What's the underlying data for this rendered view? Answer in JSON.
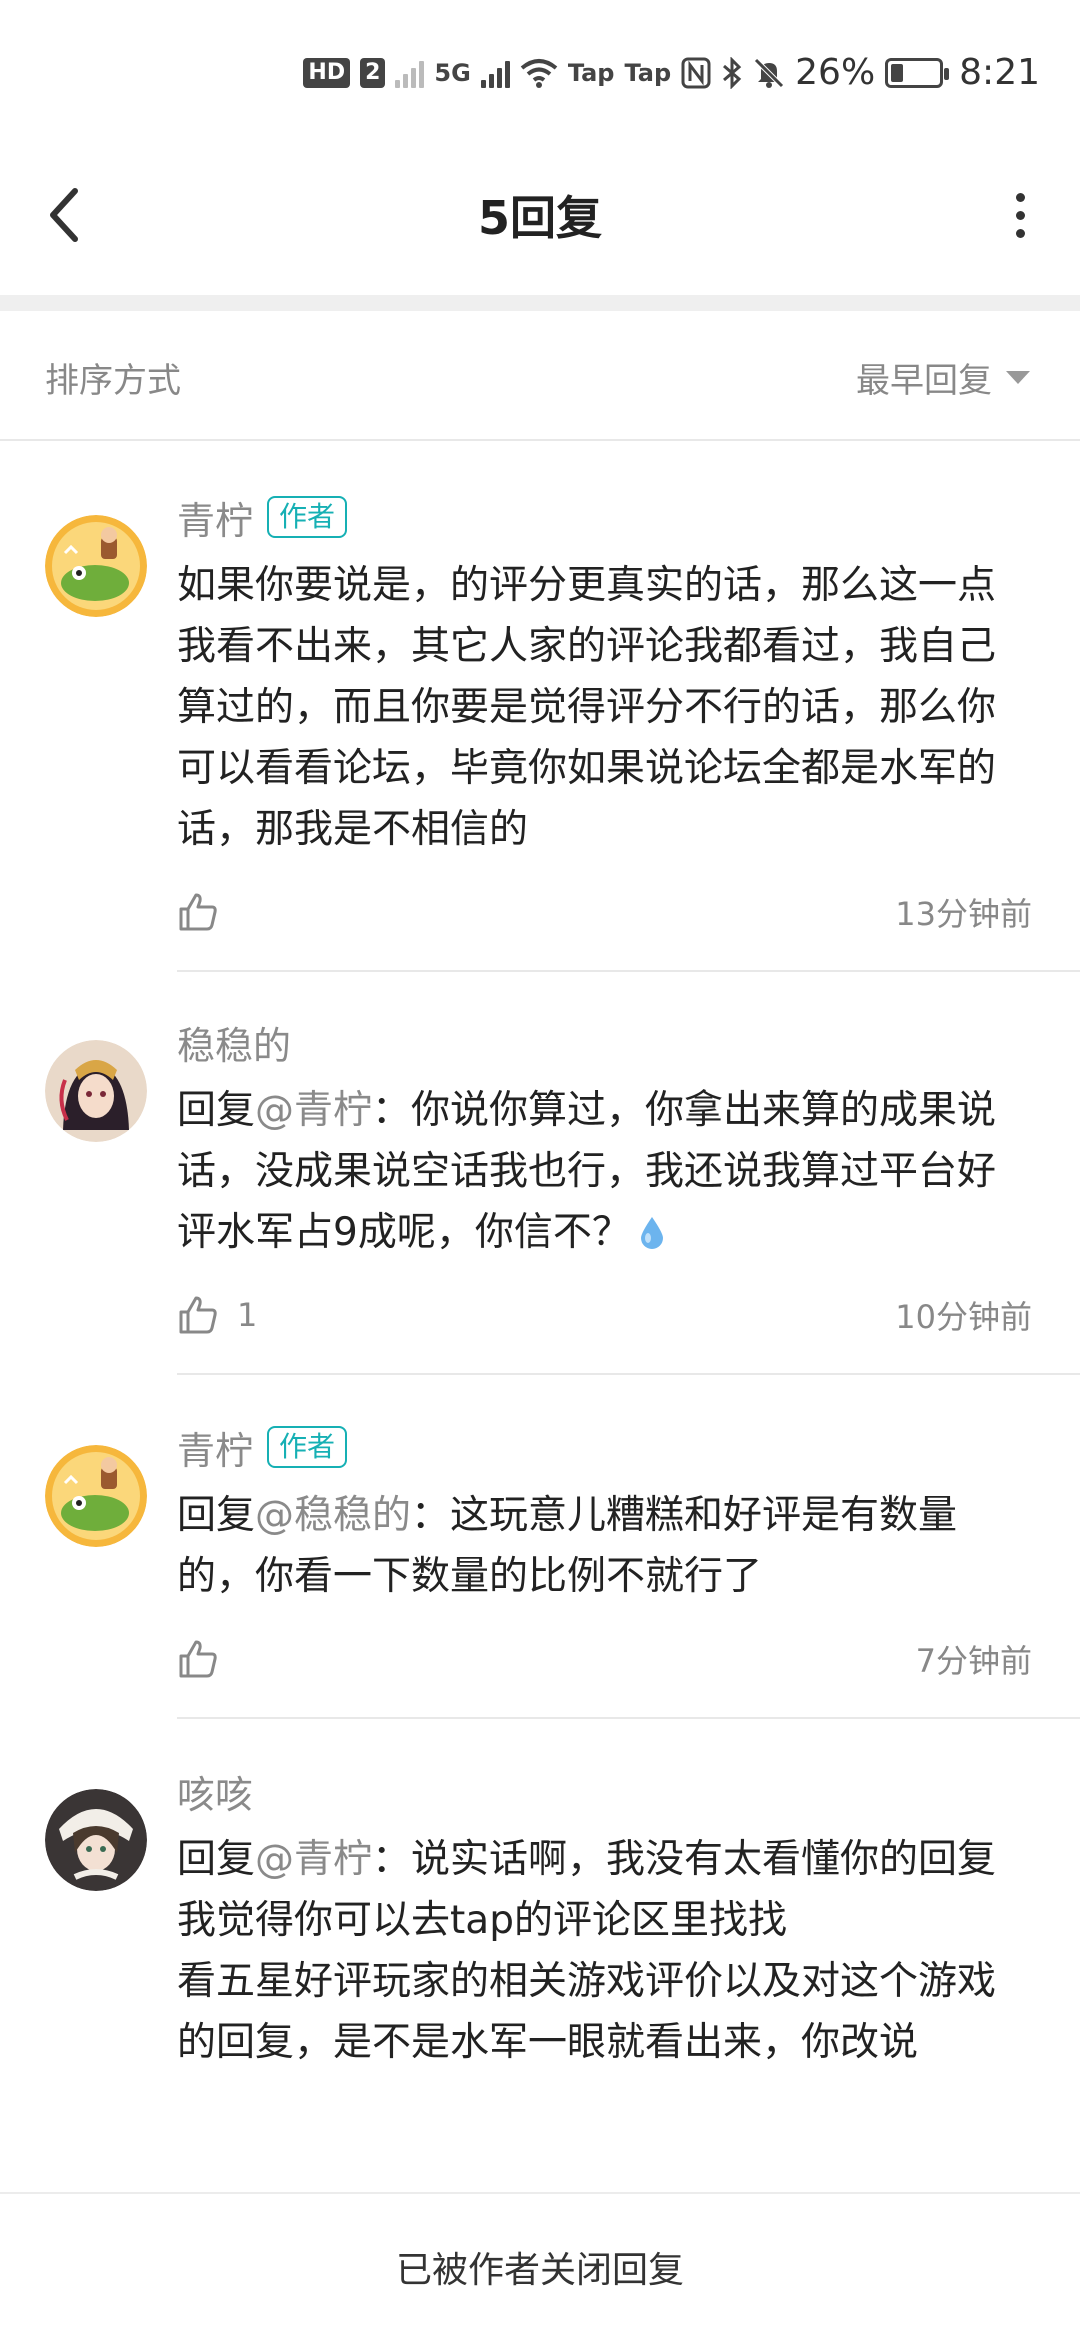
{
  "status_bar": {
    "hd_badge": "HD",
    "sim_badge": "2",
    "net_type": "5G",
    "tap1": "Tap",
    "tap2": "Tap",
    "battery": "26%",
    "battery_fill_fraction": 0.26,
    "time": "8:21",
    "icons": [
      "signal-icon",
      "wifi-icon",
      "nfc-icon",
      "bluetooth-icon",
      "mute-bell-icon",
      "battery-icon"
    ]
  },
  "header": {
    "title": "5回复",
    "back_icon": "chevron-left-icon",
    "more_icon": "more-vertical-icon"
  },
  "sort": {
    "label": "排序方式",
    "value": "最早回复"
  },
  "comments": [
    {
      "user": "青柠",
      "tag": "作者",
      "reply_prefix": "",
      "reply_to": "",
      "reply_sep": "",
      "text": "如果你要说是，的评分更真实的话，那么这一点我看不出来，其它人家的评论我都看过，我自己算过的，而且你要是觉得评分不行的话，那么你可以看看论坛，毕竟你如果说论坛全都是水军的话，那我是不相信的",
      "likes": "",
      "time": "13分钟前"
    },
    {
      "user": "稳稳的",
      "tag": "",
      "reply_prefix": "回复",
      "reply_to": "@青柠",
      "reply_sep": "：",
      "text": "你说你算过，你拿出来算的成果说话，没成果说空话我也行，我还说我算过平台好评水军占9成呢，你信不？",
      "likes": "1",
      "time": "10分钟前"
    },
    {
      "user": "青柠",
      "tag": "作者",
      "reply_prefix": "回复",
      "reply_to": "@稳稳的",
      "reply_sep": "：",
      "text": "这玩意儿糟糕和好评是有数量的，你看一下数量的比例不就行了",
      "likes": "",
      "time": "7分钟前"
    },
    {
      "user": "咳咳",
      "tag": "",
      "reply_prefix": "回复",
      "reply_to": "@青柠",
      "reply_sep": "：",
      "text": "说实话啊，我没有太看懂你的回复\n我觉得你可以去tap的评论区里找找\n看五星好评玩家的相关游戏评价以及对这个游戏的回复，是不是水军一眼就看出来，你改说",
      "likes": "",
      "time": ""
    }
  ],
  "bottom": {
    "text": "已被作者关闭回复"
  },
  "colors": {
    "author_tag": "#16b0b4",
    "muted_text": "#8a8a8a",
    "drop_emoji": "#6cb4ee"
  }
}
